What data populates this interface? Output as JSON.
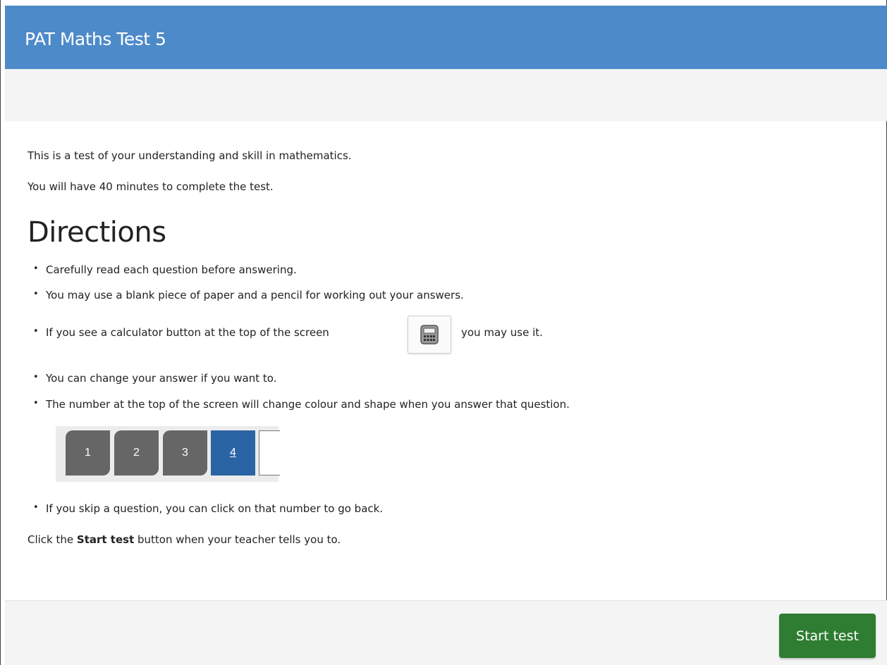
{
  "header": {
    "title": "PAT Maths Test 5"
  },
  "intro": {
    "line1": "This is a test of your understanding and skill in mathematics.",
    "line2": "You will have 40 minutes to complete the test."
  },
  "directions": {
    "heading": "Directions",
    "items": [
      "Carefully read each question before answering.",
      "You may use a blank piece of paper and a pencil for working out your answers.",
      "If you see a calculator button at the top of the screen",
      "You can change your answer if you want to.",
      "The number at the top of the screen will change colour and shape when you answer that question.",
      "If you skip a question, you can click on that number to go back."
    ],
    "calculator_suffix": "you may use it.",
    "calculator_icon": "calculator-icon"
  },
  "question_nav_example": {
    "numbers": [
      "1",
      "2",
      "3",
      "4"
    ],
    "current": "4",
    "colors": {
      "answered": "#666666",
      "current": "#2a64a4"
    }
  },
  "closing": {
    "prefix": "Click the ",
    "bold": "Start test",
    "suffix": " button when your teacher tells you to."
  },
  "footer": {
    "start_label": "Start test"
  },
  "colors": {
    "header": "#4d8ac9",
    "start_button": "#2e7d32"
  }
}
